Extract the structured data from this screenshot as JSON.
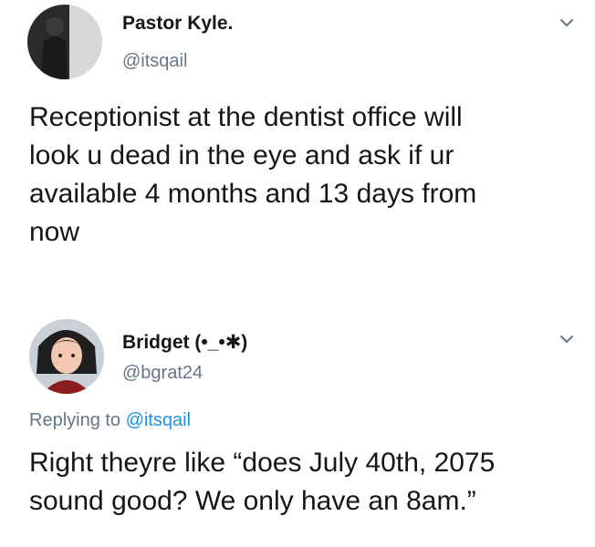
{
  "tweets": [
    {
      "display_name": "Pastor Kyle.",
      "handle": "@itsqail",
      "text": "Receptionist at the dentist office will\nlook u dead in the eye and ask if ur\navailable 4 months and 13 days from\nnow",
      "avatar_icon": "user-avatar-dark",
      "menu_icon": "chevron-down-icon"
    },
    {
      "display_name": "Bridget (•_•✱)",
      "handle": "@bgrat24",
      "replying_label": "Replying to",
      "replying_to": "@itsqail",
      "text": "Right theyre like “does July 40th, 2075\nsound good? We only have an 8am.”",
      "avatar_icon": "user-avatar-cartoon",
      "menu_icon": "chevron-down-icon"
    }
  ],
  "colors": {
    "primary_text": "#14171a",
    "secondary_text": "#657786",
    "link": "#1b95e0",
    "background": "#ffffff"
  }
}
